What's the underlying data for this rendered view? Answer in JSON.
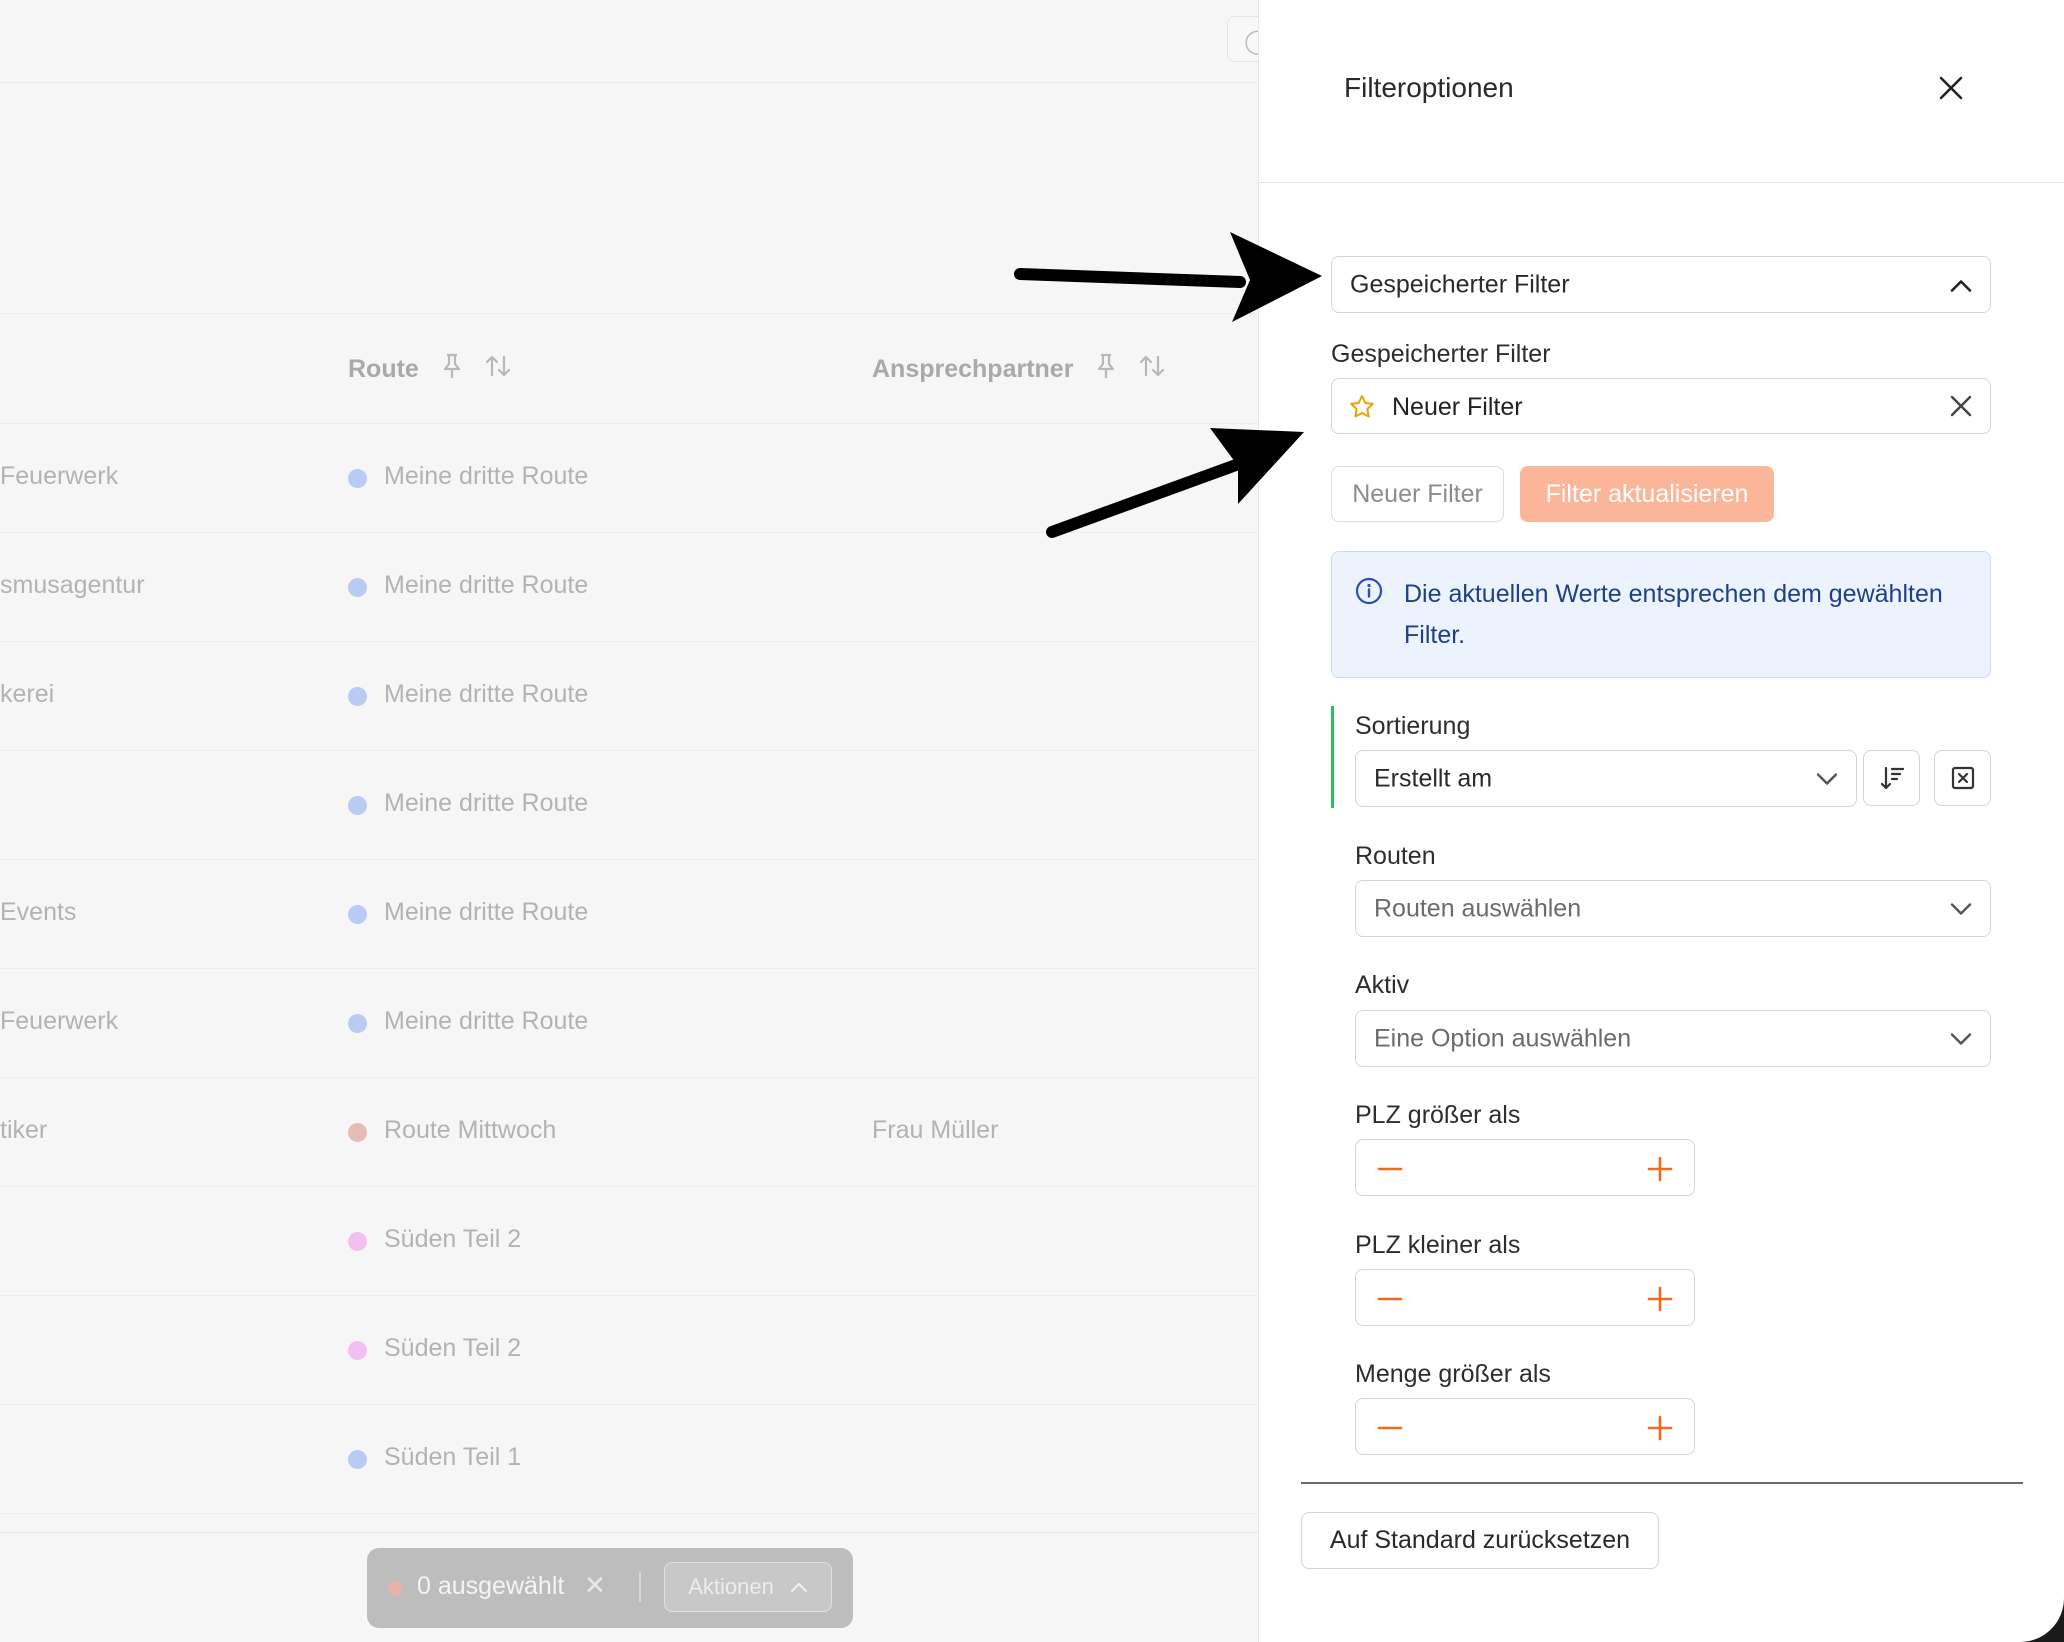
{
  "background_table": {
    "columns": [
      {
        "label": "Route"
      },
      {
        "label": "Ansprechpartner"
      }
    ],
    "rows": [
      {
        "name": "Feuerwerk",
        "route": "Meine dritte Route",
        "dot_color": "#b9cbf2",
        "contact": ""
      },
      {
        "name": "smusagentur",
        "route": "Meine dritte Route",
        "dot_color": "#b9cbf2",
        "contact": ""
      },
      {
        "name": "kerei",
        "route": "Meine dritte Route",
        "dot_color": "#b9cbf2",
        "contact": ""
      },
      {
        "name": "",
        "route": "Meine dritte Route",
        "dot_color": "#b9cbf2",
        "contact": ""
      },
      {
        "name": " Events",
        "route": "Meine dritte Route",
        "dot_color": "#b9cbf2",
        "contact": ""
      },
      {
        "name": "Feuerwerk",
        "route": "Meine dritte Route",
        "dot_color": "#b9cbf2",
        "contact": ""
      },
      {
        "name": "tiker",
        "route": "Route Mittwoch",
        "dot_color": "#e5bcb7",
        "contact": "Frau Müller"
      },
      {
        "name": "",
        "route": "Süden Teil 2",
        "dot_color": "#f1c0ef",
        "contact": ""
      },
      {
        "name": "",
        "route": "Süden Teil 2",
        "dot_color": "#f1c0ef",
        "contact": ""
      },
      {
        "name": "",
        "route": "Süden Teil 1",
        "dot_color": "#b9cbf2",
        "contact": ""
      }
    ],
    "action_bar": {
      "selected_count": "0 ausgewählt",
      "actions_label": "Aktionen"
    }
  },
  "drawer": {
    "title": "Filteroptionen",
    "saved_filter_dropdown": "Gespeicherter Filter",
    "saved_filter_label": "Gespeicherter Filter",
    "saved_filter_value": "Neuer Filter",
    "new_filter_button": "Neuer Filter",
    "update_filter_button": "Filter aktualisieren",
    "info_message": "Die aktuellen Werte entsprechen dem gewählten Filter.",
    "sorting": {
      "label": "Sortierung",
      "value": "Erstellt am"
    },
    "routes": {
      "label": "Routen",
      "placeholder": "Routen auswählen"
    },
    "active": {
      "label": "Aktiv",
      "placeholder": "Eine Option auswählen"
    },
    "plz_greater": {
      "label": "PLZ größer als"
    },
    "plz_smaller": {
      "label": "PLZ kleiner als"
    },
    "amount_greater": {
      "label": "Menge größer als"
    },
    "reset_button": "Auf Standard zurücksetzen"
  },
  "colors": {
    "accent": "#fbb69a",
    "stepper_icon": "#f06a1f",
    "info_bg": "#ecf3fd",
    "info_text": "#1f3f86",
    "active_indicator": "#2bbf57",
    "star": "#e8a400"
  },
  "icons": [
    "close-icon",
    "chevron-up-icon",
    "chevron-down-icon",
    "star-icon",
    "info-icon",
    "sort-direction-icon",
    "clear-sort-icon",
    "minus-icon",
    "plus-icon",
    "pin-icon",
    "sort-icon",
    "search-icon"
  ]
}
